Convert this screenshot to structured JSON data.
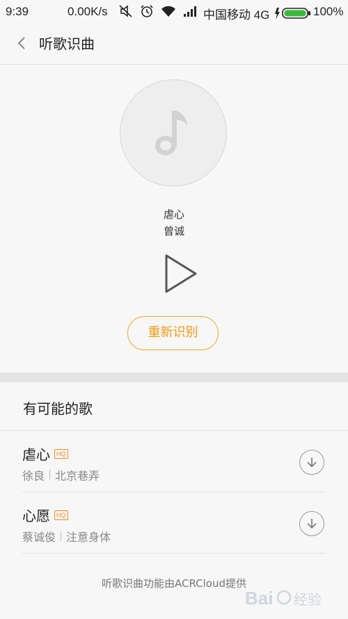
{
  "status_bar": {
    "time": "9:39",
    "net_speed": "0.00K/s",
    "carrier": "中国移动 4G",
    "battery": "100%",
    "battery_color": "#3cb83c"
  },
  "header": {
    "title": "听歌识曲",
    "back_icon": "chevron-left-icon"
  },
  "now_playing": {
    "song": "虐心",
    "artist": "曾诚",
    "retry_label": "重新识别",
    "accent": "#f2a528"
  },
  "results": {
    "heading": "有可能的歌",
    "items": [
      {
        "title": "虐心",
        "badge": "HQ",
        "artist": "徐良",
        "album": "北京巷弄"
      },
      {
        "title": "心愿",
        "badge": "HQ",
        "artist": "蔡诚俊",
        "album": "注意身体"
      }
    ],
    "footer": "听歌识曲功能由ACRCloud提供"
  },
  "watermark": "Baidu 经验"
}
